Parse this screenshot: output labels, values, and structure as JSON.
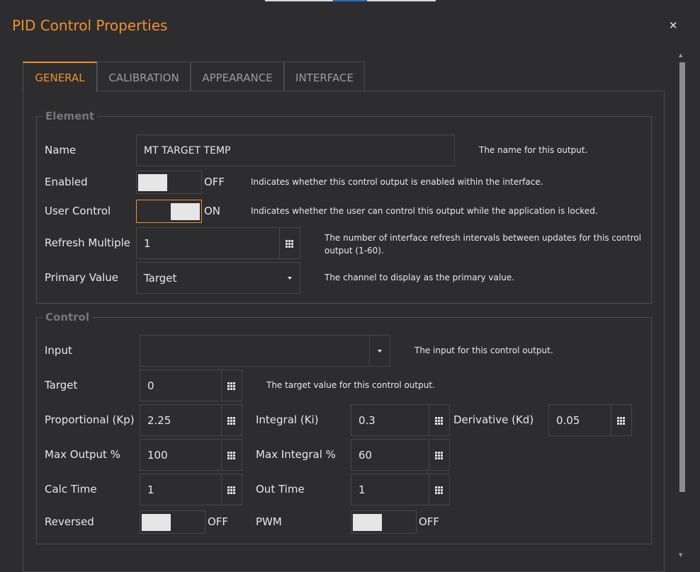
{
  "dialog": {
    "title": "PID Control Properties"
  },
  "tabs": [
    {
      "label": "GENERAL",
      "active": true
    },
    {
      "label": "CALIBRATION",
      "active": false
    },
    {
      "label": "APPEARANCE",
      "active": false
    },
    {
      "label": "INTERFACE",
      "active": false
    }
  ],
  "element_group": {
    "legend": "Element",
    "name": {
      "label": "Name",
      "value": "MT TARGET TEMP",
      "desc": "The name for this output."
    },
    "enabled": {
      "label": "Enabled",
      "state": "OFF",
      "desc": "Indicates whether this control output is enabled within the interface."
    },
    "user_control": {
      "label": "User Control",
      "state": "ON",
      "desc": "Indicates whether the user can control this output while the application is locked."
    },
    "refresh_multiple": {
      "label": "Refresh Multiple",
      "value": "1",
      "desc": "The number of interface refresh intervals between updates for this control output (1-60)."
    },
    "primary_value": {
      "label": "Primary Value",
      "value": "Target",
      "desc": "The channel to display as the primary value."
    }
  },
  "control_group": {
    "legend": "Control",
    "input": {
      "label": "Input",
      "value": "",
      "desc": "The input for this control output."
    },
    "target": {
      "label": "Target",
      "value": "0",
      "desc": "The target value for this control output."
    },
    "kp": {
      "label": "Proportional (Kp)",
      "value": "2.25"
    },
    "ki": {
      "label": "Integral (Ki)",
      "value": "0.3"
    },
    "kd": {
      "label": "Derivative (Kd)",
      "value": "0.05"
    },
    "max_output": {
      "label": "Max Output %",
      "value": "100"
    },
    "max_integral": {
      "label": "Max Integral %",
      "value": "60"
    },
    "calc_time": {
      "label": "Calc Time",
      "value": "1"
    },
    "out_time": {
      "label": "Out Time",
      "value": "1"
    },
    "reversed": {
      "label": "Reversed",
      "state": "OFF"
    },
    "pwm": {
      "label": "PWM",
      "state": "OFF"
    }
  },
  "colors": {
    "accent": "#f0902c",
    "background": "#2d2d30",
    "border": "#474747",
    "legend": "#777777"
  },
  "icons": {
    "close": "close-icon",
    "numeric": "grid-icon",
    "dropdown": "caret-down-icon"
  }
}
